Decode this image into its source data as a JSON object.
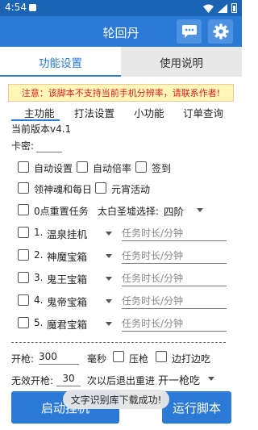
{
  "status_bar": {
    "time": "4:54"
  },
  "app_bar": {
    "title": "轮回丹",
    "chat_icon": "chat-bubble-icon",
    "settings_icon": "gear-icon"
  },
  "tabs": [
    {
      "label": "功能设置",
      "active": true
    },
    {
      "label": "使用说明",
      "active": false
    }
  ],
  "notice": "注意：该脚本不支持当前手机分辨率，请联系作者!",
  "sub_tabs": [
    {
      "label": "主功能",
      "active": true
    },
    {
      "label": "打法设置",
      "active": false
    },
    {
      "label": "小功能",
      "active": false
    },
    {
      "label": "订单查询",
      "active": false
    }
  ],
  "version": "当前版本v4.1",
  "secret_label": "卡密:",
  "secret_value": "",
  "options": {
    "auto_settings": "自动设置",
    "auto_multiplier": "自动倍率",
    "sign_in": "签到",
    "claim_daily": "领神魂和每日",
    "lantern_event": "元宵活动",
    "reset_midnight": "0点重置任务",
    "taibai_label": "太白圣墟选择:",
    "taibai_value": "四阶"
  },
  "tasks": [
    {
      "num": "1.",
      "name": "温泉挂机",
      "placeholder": "任务时长/分钟"
    },
    {
      "num": "2.",
      "name": "神魔宝箱",
      "placeholder": "任务时长/分钟"
    },
    {
      "num": "3.",
      "name": "鬼王宝箱",
      "placeholder": "任务时长/分钟"
    },
    {
      "num": "4.",
      "name": "鬼帝宝箱",
      "placeholder": "任务时长/分钟"
    },
    {
      "num": "5.",
      "name": "魔君宝箱",
      "placeholder": "任务时长/分钟"
    }
  ],
  "fire": {
    "label": "开枪:",
    "value": "300",
    "unit": "毫秒",
    "press_label": "压枪",
    "edge_label": "边打边吃"
  },
  "invalid": {
    "label": "无效开枪:",
    "value": "30",
    "after": "次以后退出重进",
    "mode": "开一枪吃"
  },
  "buttons": {
    "start": "启动挂机",
    "run": "运行脚本"
  },
  "toast": "文字识别库下载成功!",
  "colors": {
    "primary": "#2b7ad6",
    "status_bar": "#1b63b3",
    "notice_text": "#e02020",
    "notice_bg": "#fff6b8"
  }
}
